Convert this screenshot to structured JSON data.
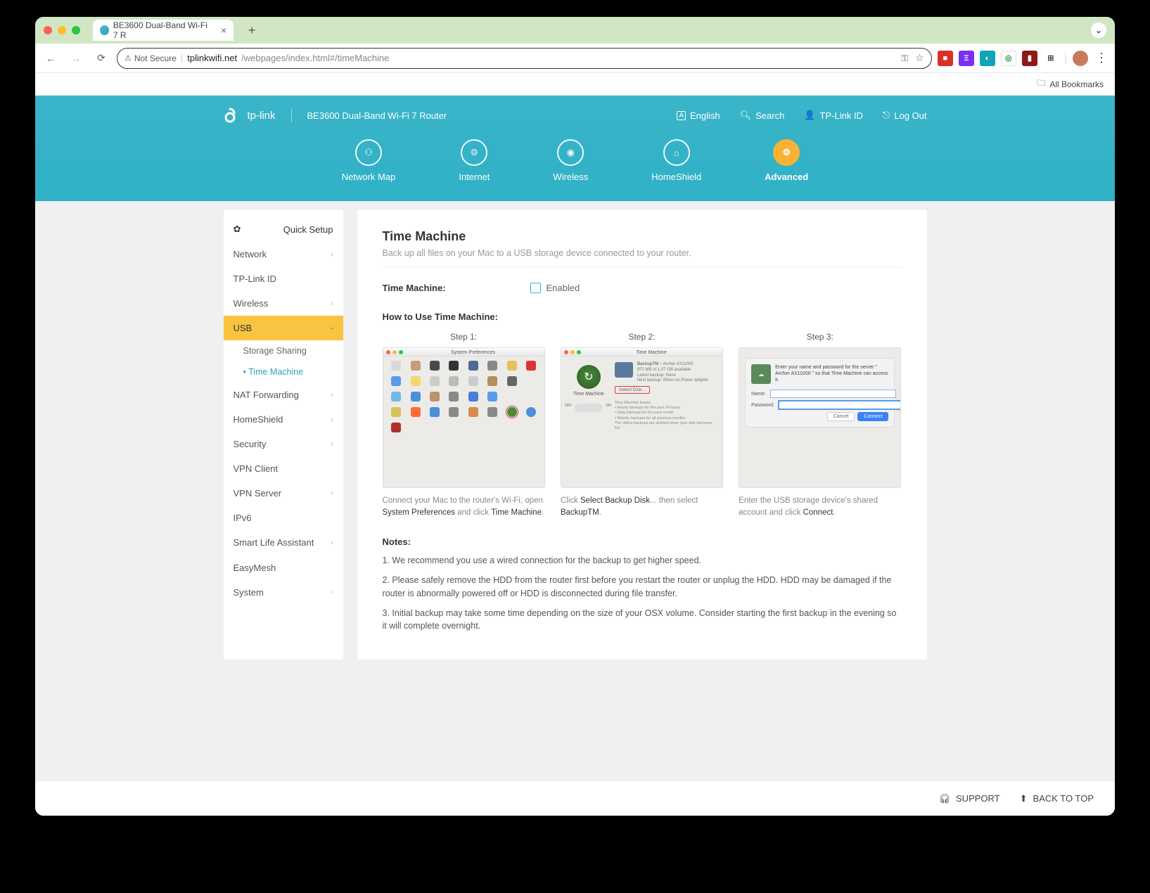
{
  "browser": {
    "tab_title": "BE3600 Dual-Band Wi-Fi 7 R",
    "not_secure": "Not Secure",
    "host": "tplinkwifi.net",
    "path": "/webpages/index.html#/timeMachine",
    "all_bookmarks": "All Bookmarks"
  },
  "header": {
    "brand": "tp-link",
    "product": "BE3600 Dual-Band Wi-Fi 7 Router",
    "lang": "English",
    "search": "Search",
    "tpid": "TP-Link ID",
    "logout": "Log Out"
  },
  "navtabs": {
    "map": "Network Map",
    "internet": "Internet",
    "wireless": "Wireless",
    "shield": "HomeShield",
    "advanced": "Advanced"
  },
  "sidebar": {
    "quick": "Quick Setup",
    "network": "Network",
    "tpid": "TP-Link ID",
    "wireless": "Wireless",
    "usb": "USB",
    "storage": "Storage Sharing",
    "tm": "Time Machine",
    "nat": "NAT Forwarding",
    "shield": "HomeShield",
    "security": "Security",
    "vpnc": "VPN Client",
    "vpns": "VPN Server",
    "ipv6": "IPv6",
    "sla": "Smart Life Assistant",
    "mesh": "EasyMesh",
    "system": "System"
  },
  "content": {
    "title": "Time Machine",
    "subtitle": "Back up all files on your Mac to a USB storage device connected to your router.",
    "field_label": "Time Machine:",
    "enabled": "Enabled",
    "howto": "How to Use Time Machine:",
    "steps": {
      "s1": "Step 1:",
      "s2": "Step 2:",
      "s3": "Step 3:",
      "s1_win": "System Preferences",
      "s2_win": "Time Machine",
      "tm_label": "Time Machine",
      "tm_off": "OFF",
      "tm_on": "ON",
      "tm_seldisk": "Select Disk...",
      "s3_prompt": "Enter your name and password for the server \" Archer AX11000 \" so that Time Machine can access it.",
      "s3_name": "Name:",
      "s3_pass": "Password:",
      "s3_cancel": "Cancel",
      "s3_connect": "Connect",
      "d1_a": "Connect your Mac to the router's Wi-Fi, open ",
      "d1_b": "System Preferences",
      "d1_c": " and click ",
      "d1_d": "Time Machine",
      "d1_e": ".",
      "d2_a": "Click ",
      "d2_b": "Select Backup Disk",
      "d2_c": "... then select ",
      "d2_d": "BackupTM",
      "d2_e": ".",
      "d3_a": "Enter the USB storage device's shared account and click ",
      "d3_b": "Connect",
      "d3_c": "."
    },
    "notes_title": "Notes:",
    "note1": "1. We recommend you use a wired connection for the backup to get higher speed.",
    "note2": "2. Please safely remove the HDD from the router first before you restart the router or unplug the HDD. HDD may be damaged if the router is abnormally powered off or HDD is disconnected during file transfer.",
    "note3": "3. Initial backup may take some time depending on the size of your OSX volume. Consider starting the first backup in the evening so it will complete overnight."
  },
  "footer": {
    "support": "SUPPORT",
    "top": "BACK TO TOP"
  }
}
